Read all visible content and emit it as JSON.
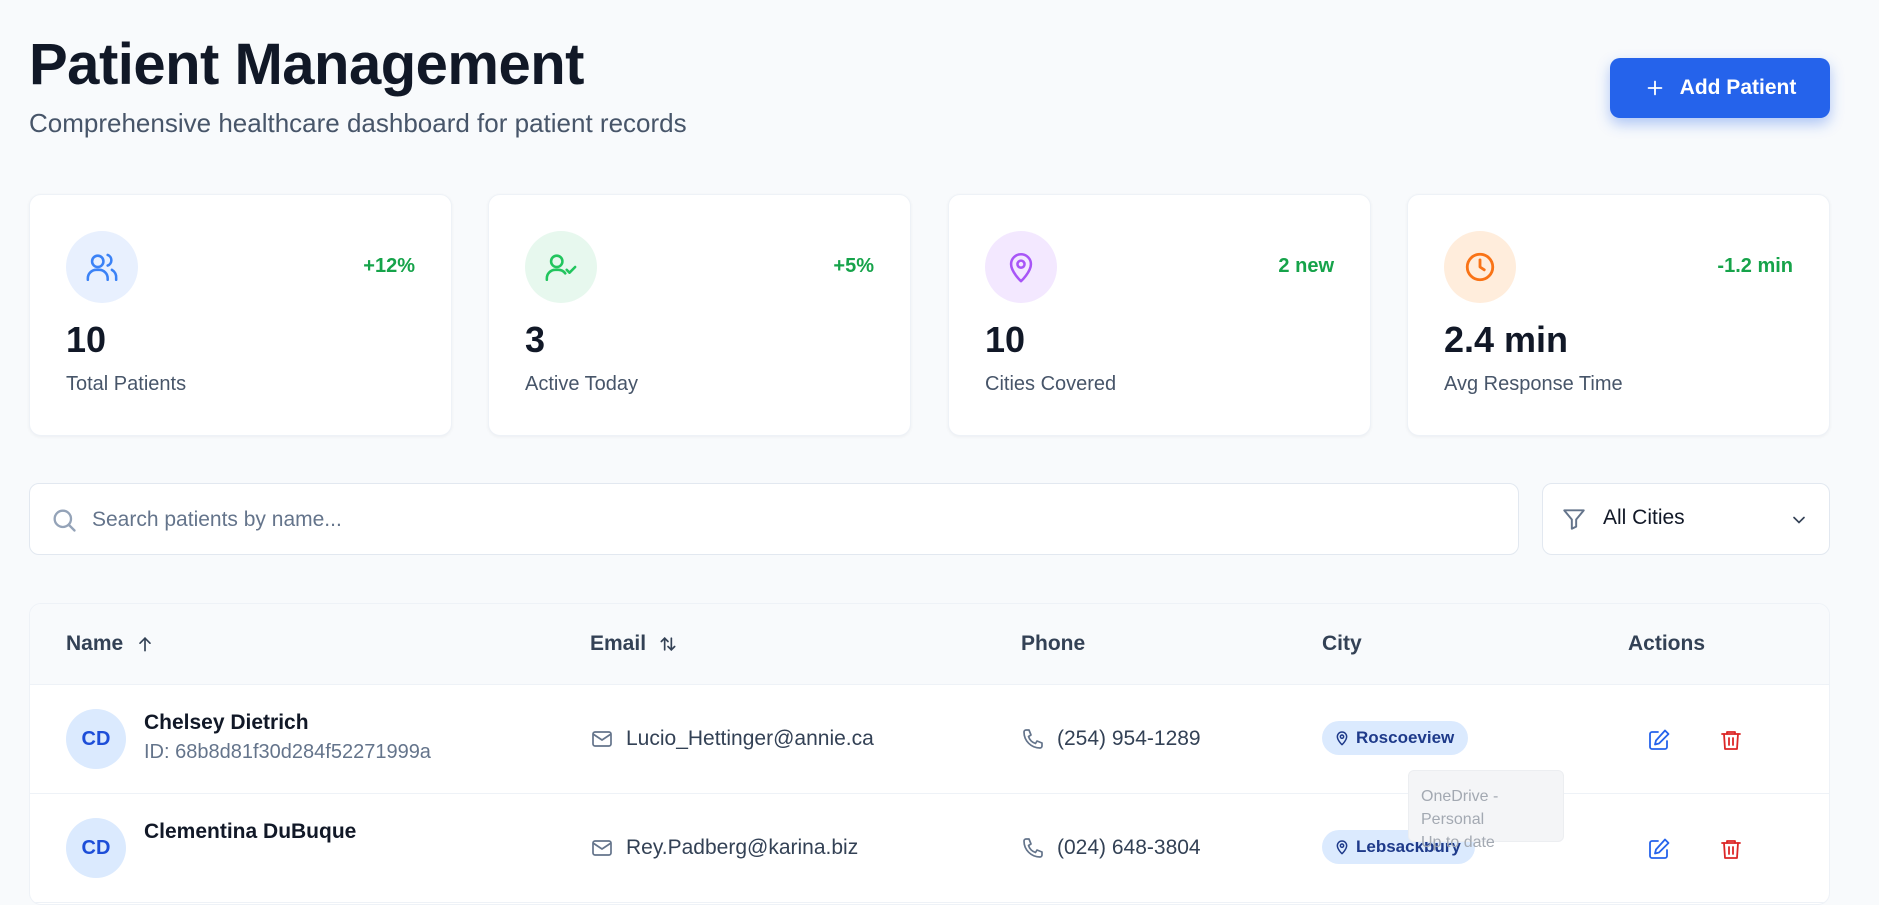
{
  "header": {
    "title": "Patient Management",
    "subtitle": "Comprehensive healthcare dashboard for patient records",
    "add_button_label": "Add Patient"
  },
  "stats": [
    {
      "icon": "users-icon",
      "delta": "+12%",
      "value": "10",
      "label": "Total Patients",
      "icon_color": "#3b82f6",
      "icon_bg": "#e8f0fe"
    },
    {
      "icon": "user-check-icon",
      "delta": "+5%",
      "value": "3",
      "label": "Active Today",
      "icon_color": "#22c55e",
      "icon_bg": "#e7f8ee"
    },
    {
      "icon": "map-pin-icon",
      "delta": "2 new",
      "value": "10",
      "label": "Cities Covered",
      "icon_color": "#a855f7",
      "icon_bg": "#f3e8ff"
    },
    {
      "icon": "clock-icon",
      "delta": "-1.2 min",
      "value": "2.4 min",
      "label": "Avg Response Time",
      "icon_color": "#f97316",
      "icon_bg": "#ffeddc"
    }
  ],
  "search": {
    "placeholder": "Search patients by name...",
    "value": ""
  },
  "filter": {
    "selected": "All Cities"
  },
  "table": {
    "columns": [
      "Name",
      "Email",
      "Phone",
      "City",
      "Actions"
    ],
    "rows": [
      {
        "initials": "CD",
        "name": "Chelsey Dietrich",
        "id": "ID: 68b8d81f30d284f52271999a",
        "email": "Lucio_Hettinger@annie.ca",
        "phone": "(254) 954-1289",
        "city": "Roscoeview"
      },
      {
        "initials": "CD",
        "name": "Clementina DuBuque",
        "id": "",
        "email": "Rey.Padberg@karina.biz",
        "phone": "(024) 648-3804",
        "city": "Lebsackbury"
      }
    ]
  },
  "toast": {
    "line1": "OneDrive - Personal",
    "line2": "Up to date"
  },
  "colors": {
    "primary": "#2563eb",
    "positive": "#16a34a",
    "danger": "#dc2626"
  }
}
